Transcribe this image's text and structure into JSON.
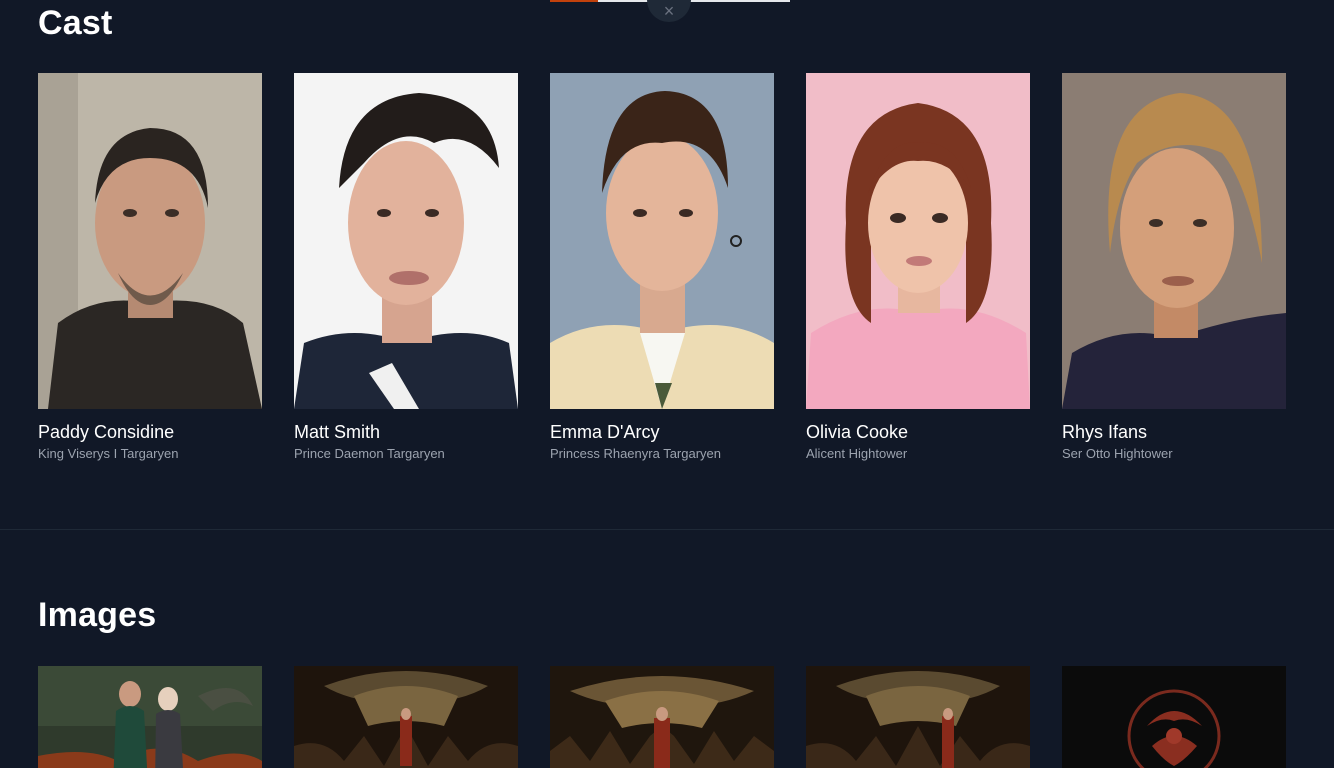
{
  "overlay": {
    "close_symbol": "×",
    "accent_color": "#c2410c"
  },
  "cast": {
    "title": "Cast",
    "members": [
      {
        "name": "Paddy Considine",
        "role": "King Viserys I Targaryen",
        "bg": "#b9b3a6"
      },
      {
        "name": "Matt Smith",
        "role": "Prince Daemon Targaryen",
        "bg": "#f3f3f3"
      },
      {
        "name": "Emma D'Arcy",
        "role": "Princess Rhaenyra Targaryen",
        "bg": "#8ea0b3"
      },
      {
        "name": "Olivia Cooke",
        "role": "Alicent Hightower",
        "bg": "#f0b8c4"
      },
      {
        "name": "Rhys Ifans",
        "role": "Ser Otto Hightower",
        "bg": "#8a7b72"
      }
    ]
  },
  "images": {
    "title": "Images",
    "items": [
      {
        "icon": "poster-two-figures"
      },
      {
        "icon": "dragon-throne-scene"
      },
      {
        "icon": "dragon-throne-scene"
      },
      {
        "icon": "dragon-throne-scene"
      },
      {
        "icon": "targaryen-sigil"
      }
    ]
  },
  "colors": {
    "background": "#111827",
    "secondary_text": "#9ca3af"
  }
}
